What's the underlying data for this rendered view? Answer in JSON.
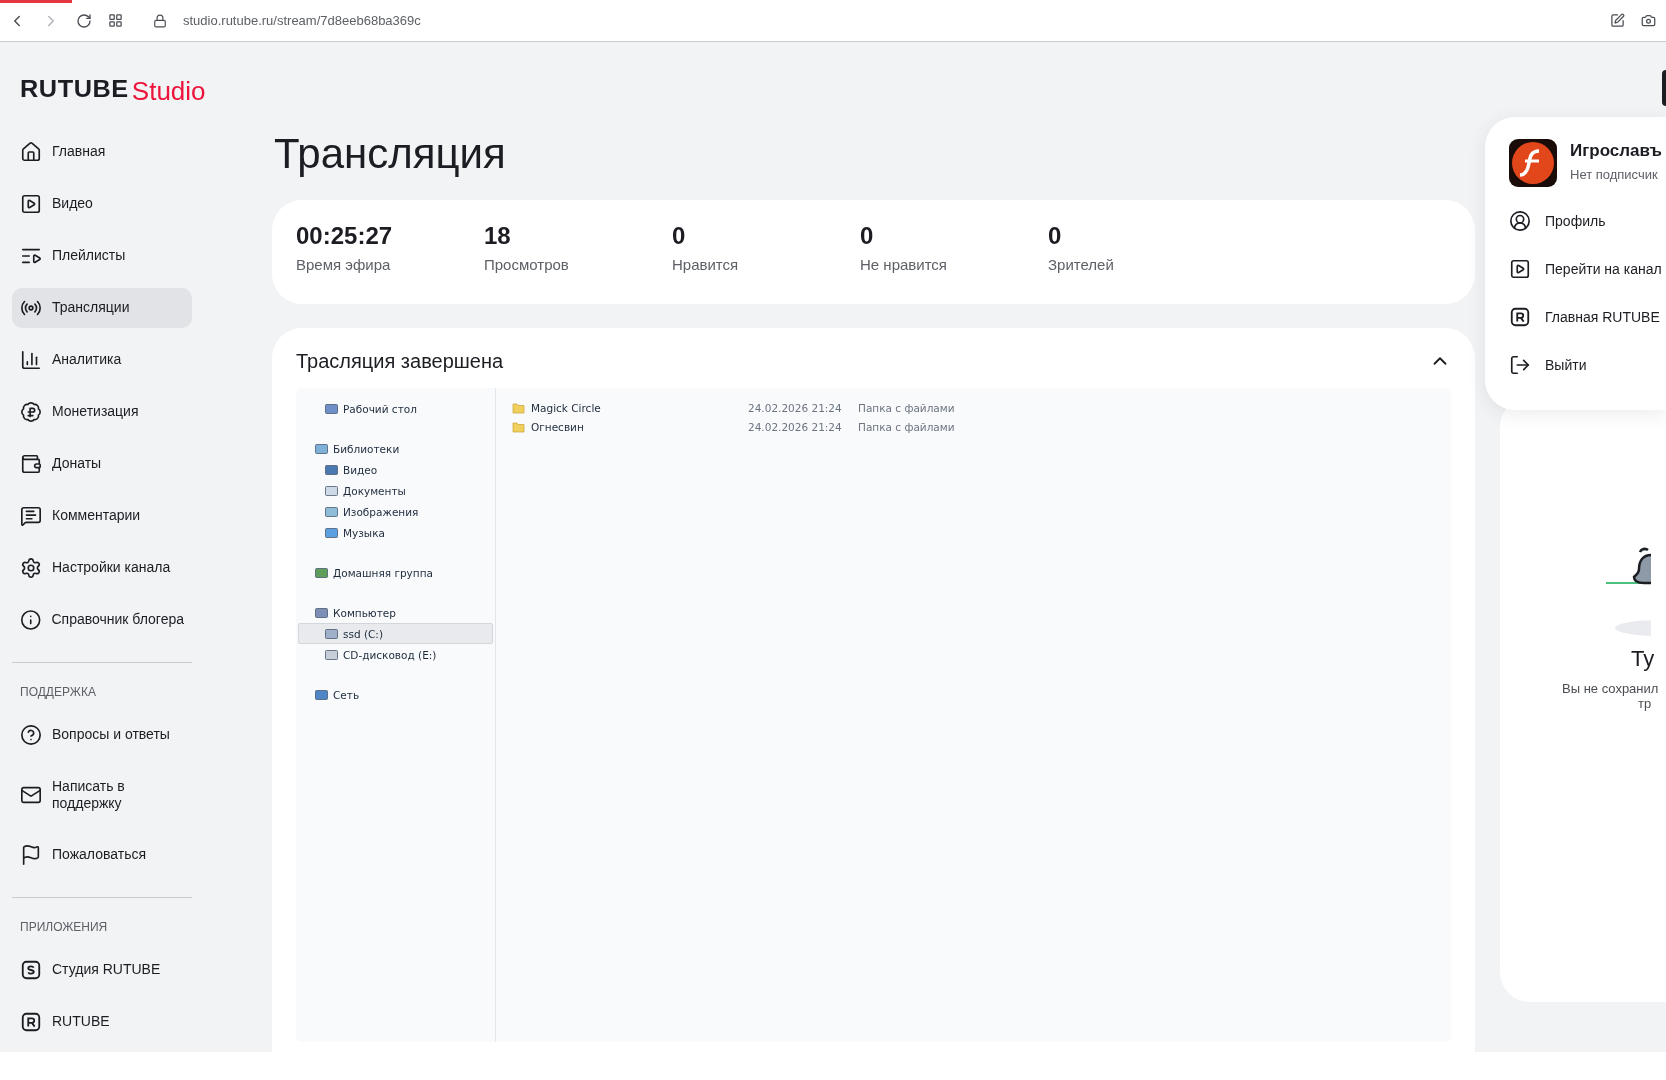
{
  "browser": {
    "url": "studio.rutube.ru/stream/7d8eeb68ba369c"
  },
  "logo": {
    "brand": "RUTUBE",
    "product": "Studio"
  },
  "sidebar": {
    "items": [
      {
        "label": "Главная",
        "selected": false
      },
      {
        "label": "Видео",
        "selected": false
      },
      {
        "label": "Плейлисты",
        "selected": false
      },
      {
        "label": "Трансляции",
        "selected": true
      },
      {
        "label": "Аналитика",
        "selected": false
      },
      {
        "label": "Монетизация",
        "selected": false
      },
      {
        "label": "Донаты",
        "selected": false
      },
      {
        "label": "Комментарии",
        "selected": false
      },
      {
        "label": "Настройки канала",
        "selected": false
      },
      {
        "label": "Справочник блогера",
        "selected": false
      }
    ],
    "sections": [
      {
        "heading": "ПОДДЕРЖКА",
        "items": [
          {
            "label": "Вопросы и ответы"
          },
          {
            "label": "Написать в поддержку"
          },
          {
            "label": "Пожаловаться"
          }
        ]
      },
      {
        "heading": "ПРИЛОЖЕНИЯ",
        "items": [
          {
            "label": "Студия RUTUBE"
          },
          {
            "label": "RUTUBE"
          }
        ]
      }
    ]
  },
  "page_title": "Трансляция",
  "stats": [
    {
      "value": "00:25:27",
      "label": "Время эфира"
    },
    {
      "value": "18",
      "label": "Просмотров"
    },
    {
      "value": "0",
      "label": "Нравится"
    },
    {
      "value": "0",
      "label": "Не нравится"
    },
    {
      "value": "0",
      "label": "Зрителей"
    }
  ],
  "stream": {
    "title": "Трасляция завершена",
    "expanded": true,
    "explorer": {
      "nav": [
        {
          "children": [
            {
              "label": "Рабочий стол",
              "selected": false
            }
          ]
        },
        {
          "label": "Библиотеки",
          "selected": false,
          "children": [
            {
              "label": "Видео",
              "selected": false
            },
            {
              "label": "Документы",
              "selected": false
            },
            {
              "label": "Изображения",
              "selected": false
            },
            {
              "label": "Музыка",
              "selected": false
            }
          ]
        },
        {
          "label": "Домашняя группа",
          "selected": false
        },
        {
          "label": "Компьютер",
          "selected": false,
          "children": [
            {
              "label": "ssd (C:)",
              "selected": true
            },
            {
              "label": "CD-дисковод (E:)",
              "selected": false
            }
          ]
        },
        {
          "label": "Сеть",
          "selected": false
        }
      ],
      "files": [
        {
          "name": "Magick Circle",
          "date": "24.02.2026 21:24",
          "type": "Папка с файлами"
        },
        {
          "name": "Огнесвин",
          "date": "24.02.2026 21:24",
          "type": "Папка с файлами"
        }
      ]
    }
  },
  "profile_menu": {
    "name": "Игрославъ",
    "subtitle": "Нет подписчик",
    "items": [
      {
        "label": "Профиль"
      },
      {
        "label": "Перейти на канал"
      },
      {
        "label": "Главная RUTUBE"
      },
      {
        "label": "Выйти"
      }
    ]
  },
  "side_panel": {
    "title": "Ту",
    "lines": [
      "Вы не сохранил",
      "тр"
    ]
  }
}
